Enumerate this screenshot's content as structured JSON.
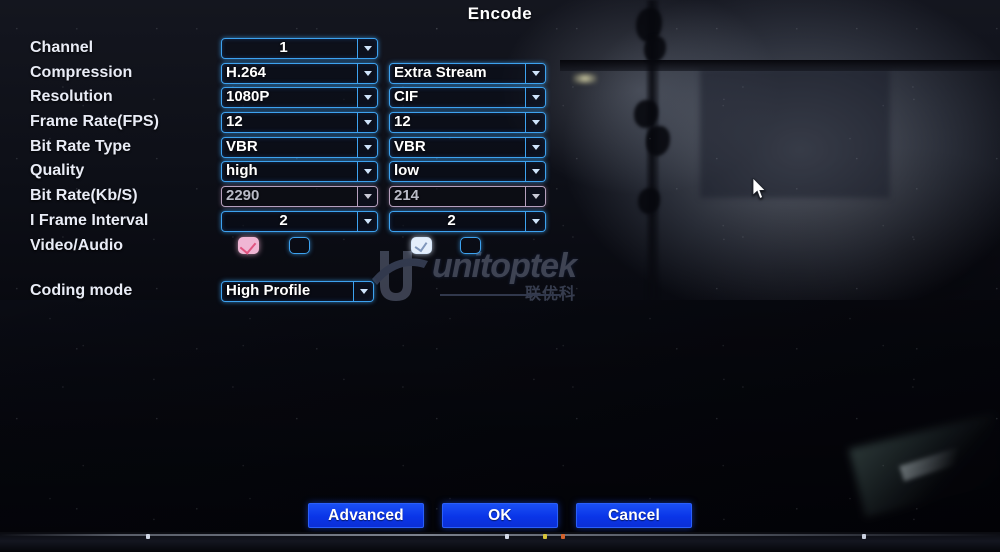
{
  "dialog": {
    "title": "Encode"
  },
  "columns": {
    "main_stream": "",
    "extra_stream": "Extra Stream"
  },
  "fields": [
    {
      "label": "Channel",
      "main": "1",
      "extra": null,
      "disabled": false,
      "main_align": "center"
    },
    {
      "label": "Compression",
      "main": "H.264",
      "extra": "Extra Stream",
      "disabled": false,
      "main_align": "left"
    },
    {
      "label": "Resolution",
      "main": "1080P",
      "extra": "CIF",
      "disabled": false,
      "main_align": "left"
    },
    {
      "label": "Frame Rate(FPS)",
      "main": "12",
      "extra": "12",
      "disabled": false,
      "main_align": "left"
    },
    {
      "label": "Bit Rate Type",
      "main": "VBR",
      "extra": "VBR",
      "disabled": false,
      "main_align": "left"
    },
    {
      "label": "Quality",
      "main": "high",
      "extra": "low",
      "disabled": false,
      "main_align": "left"
    },
    {
      "label": "Bit Rate(Kb/S)",
      "main": "2290",
      "extra": "214",
      "disabled": true,
      "main_align": "left"
    },
    {
      "label": "I Frame Interval",
      "main": "2",
      "extra": "2",
      "disabled": false,
      "main_align": "center"
    }
  ],
  "video_audio": {
    "label": "Video/Audio",
    "main_video_checked": true,
    "main_audio_checked": false,
    "extra_video_checked": true,
    "extra_audio_checked": false
  },
  "coding_mode": {
    "label": "Coding mode",
    "value": "High Profile"
  },
  "buttons": {
    "advanced": "Advanced",
    "ok": "OK",
    "cancel": "Cancel"
  },
  "watermark": {
    "name": "unitoptek",
    "subtitle": "联优科"
  },
  "colors": {
    "field_border": "#3da2ef",
    "field_border_disabled": "#b6a0bd",
    "button_blue": "#0a35e8",
    "checkbox_pink": "#f0b6d4",
    "checkbox_white": "#e4eefb",
    "label_text": "#e9ecf6"
  }
}
